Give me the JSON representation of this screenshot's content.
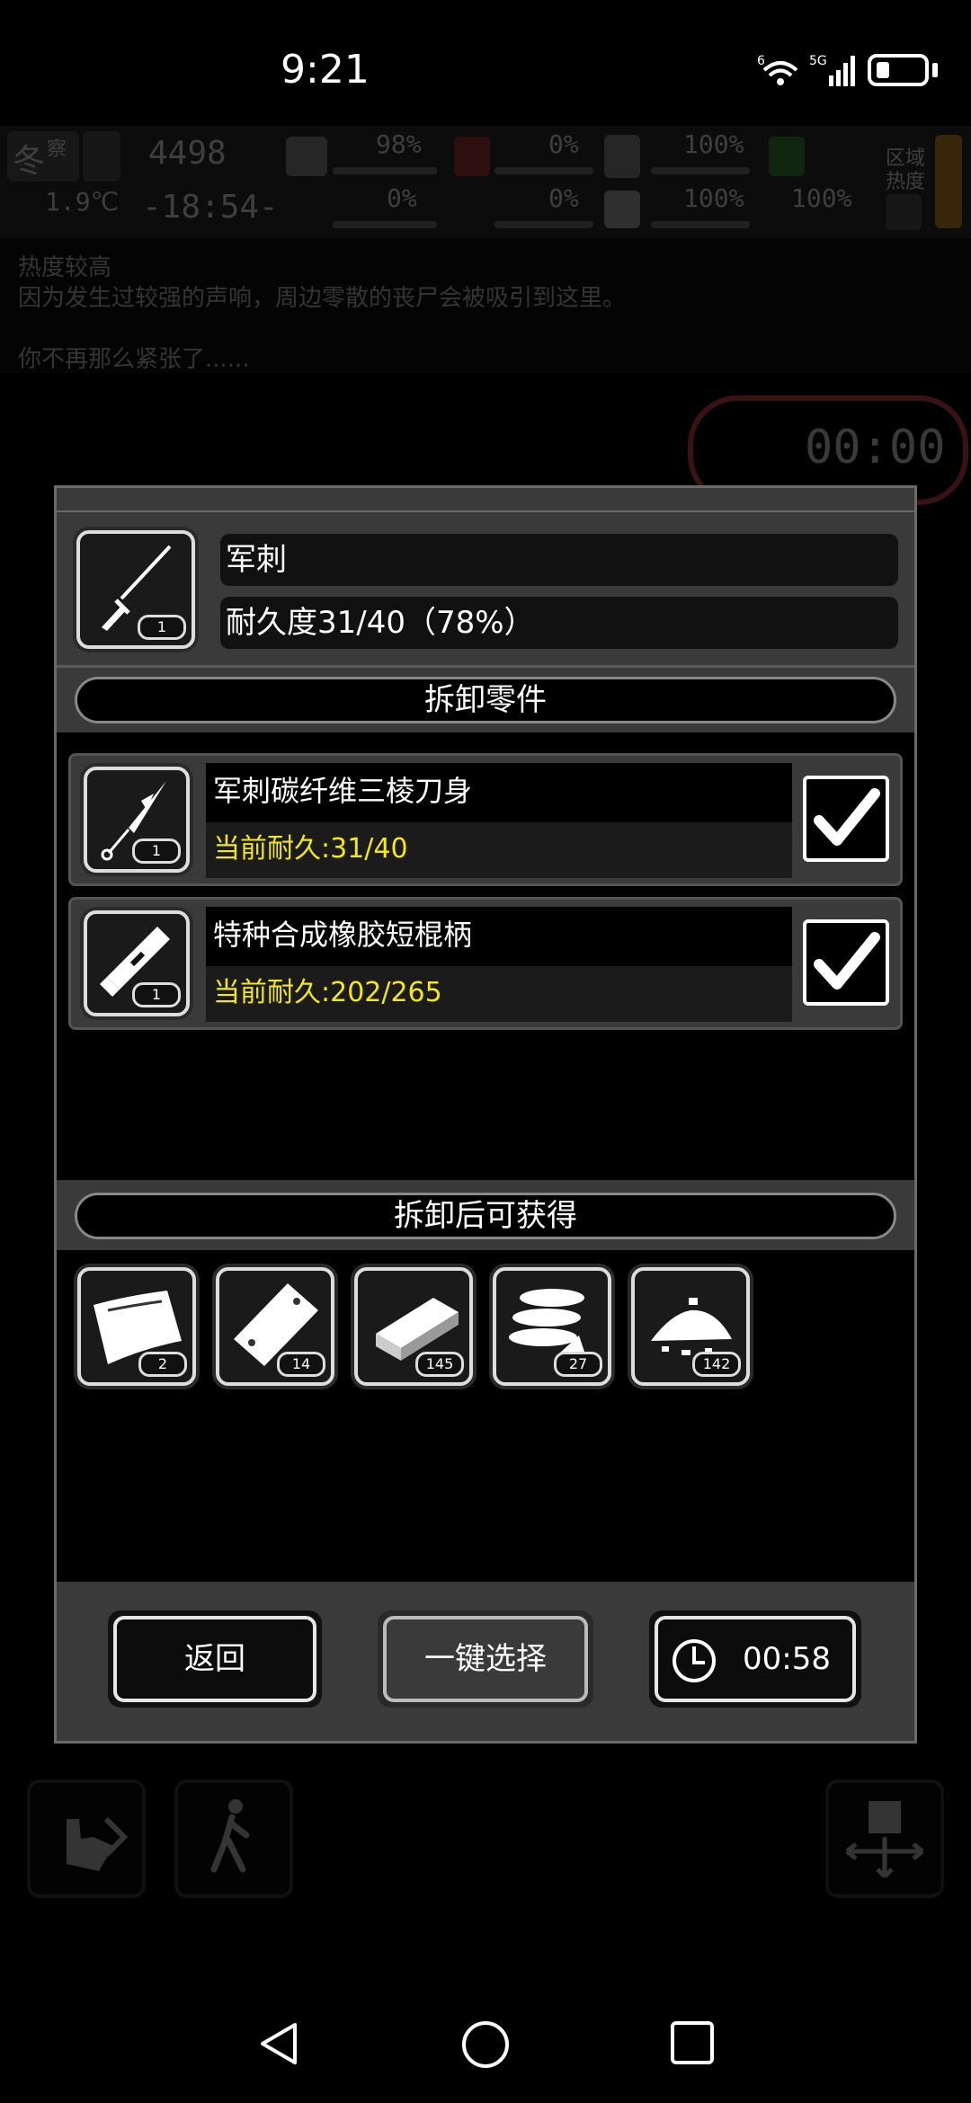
{
  "status_bar": {
    "time": "9:21",
    "wifi_label": "6",
    "network_label": "5G"
  },
  "background": {
    "hud": {
      "season": "冬",
      "season_sub": "察",
      "temperature": "1.9℃",
      "day_counter": "4498",
      "game_time": "-18:54-",
      "stats_left": [
        "98%",
        "0%"
      ],
      "stats_mid": [
        "0%",
        "0%"
      ],
      "stats_right": [
        "100%",
        "100%"
      ],
      "stats_far": [
        "100%"
      ],
      "area_label_line1": "区域",
      "area_label_line2": "热度"
    },
    "log_lines": [
      "热度较高",
      "因为发生过较强的声响，周边零散的丧尸会被吸引到这里。",
      "",
      "你不再那么紧张了......"
    ],
    "timer_text": "00:00"
  },
  "item": {
    "icon": "bayonet-icon",
    "count": "1",
    "name": "军刺",
    "durability": "耐久度31/40（78%）"
  },
  "sections": {
    "parts_title": "拆卸零件",
    "yield_title": "拆卸后可获得"
  },
  "parts": [
    {
      "icon": "blade-icon",
      "count": "1",
      "name": "军刺碳纤维三棱刀身",
      "durability": "当前耐久:31/40",
      "checked": true
    },
    {
      "icon": "handle-icon",
      "count": "1",
      "name": "特种合成橡胶短棍柄",
      "durability": "当前耐久:202/265",
      "checked": true
    }
  ],
  "yields": [
    {
      "icon": "cloth-icon",
      "count": "2"
    },
    {
      "icon": "plastic-sheet-icon",
      "count": "14"
    },
    {
      "icon": "metal-bar-icon",
      "count": "145"
    },
    {
      "icon": "rubber-rolls-icon",
      "count": "27"
    },
    {
      "icon": "scrap-pile-icon",
      "count": "142"
    }
  ],
  "buttons": {
    "back": "返回",
    "select_all": "一键选择",
    "timer": "00:58"
  },
  "colors": {
    "durability_text": "#f2e71e",
    "panel_gray": "#3a3a3a",
    "background": "#000000"
  }
}
